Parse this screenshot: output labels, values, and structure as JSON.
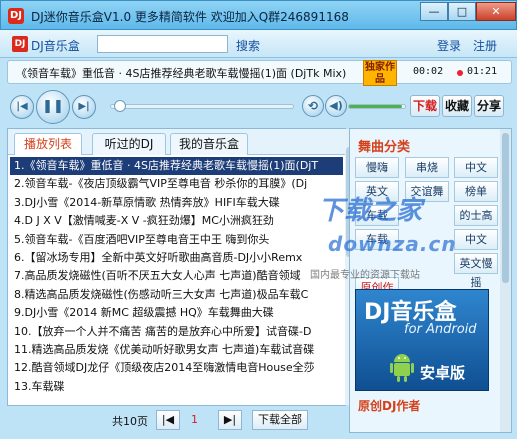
{
  "window": {
    "title": "DJ迷你音乐盒V1.0   更多精简软件 欢迎加入Q群246891168",
    "min_label": "—",
    "max_label": "□",
    "close_label": "✕"
  },
  "menubar": {
    "logo": "DJ音乐盒",
    "search_label": "搜索",
    "login_label": "登录",
    "register_label": "注册"
  },
  "now_playing": {
    "title": "《领音车载》重低音 · 4S店推荐经典老歌车载慢摇(1)面 (DjTk Mix)",
    "badge": "独家作品",
    "elapsed": "00:02",
    "duration": "01:21",
    "progress": 0.02,
    "volume": 0.95
  },
  "actions": {
    "download": "下载",
    "favorite": "收藏",
    "share": "分享"
  },
  "tabs": [
    "播放列表",
    "听过的DJ",
    "我的音乐盒"
  ],
  "playlist": [
    "1.《领音车载》重低音 · 4S店推荐经典老歌车载慢摇(1)面(DjT",
    "2.领音车载-《夜店顶级霸气VIP至尊电音 秒杀你的耳膜》(Dj",
    "3.DJ小雪《2014-新草原情歌 热情奔放》HIFI车载大碟",
    "4.D J X V【激情喊麦-X V -疯狂劲爆】MC小洲疯狂劲",
    "5.领音车载-《百度酒吧VIP至尊电音王中王 嗨到你头",
    "6.【留冰场专用】全新中英文好听歌曲高音质-DJ小小Remx",
    "7.高品质发烧磁性(百听不厌五大女人心声 七声道)酷音领域",
    "8.精选高品质发烧磁性(伤感动听三大女声 七声道)极品车载C",
    "9.DJ小雪《2014 新MC 超级震撼 HQ》车载舞曲大碟",
    "10.【放弃一个人并不痛苦 痛苦的是放弃心中所爱】试音碟-D",
    "11.精选高品质发烧《优美动听好歌男女声 七声道)车载试音碟",
    "12.酷音领域DJ龙仔《顶级夜店2014至嗨激情电音House全莎",
    "13.车载碟"
  ],
  "pagination": {
    "total": "共10页",
    "first": "|◀",
    "current": "1",
    "next": "▶|",
    "download_all": "下载全部"
  },
  "categories": {
    "title": "舞曲分类",
    "items": [
      "慢嗨",
      "串烧",
      "中文",
      "英文",
      "交谊舞",
      "榜单",
      "车载",
      "",
      "的士高",
      "车载",
      "",
      "中文Club",
      "",
      "",
      "英文慢摇",
      "原创作品"
    ]
  },
  "ad": {
    "title": "DJ音乐盒",
    "subtitle": "for Android",
    "bottom": "安卓版"
  },
  "watermark": {
    "line1": "下载之家",
    "line2": "downza.cn",
    "line3": "国内最专业的资源下载站"
  },
  "author_section": {
    "title": "原创DJ作者"
  }
}
